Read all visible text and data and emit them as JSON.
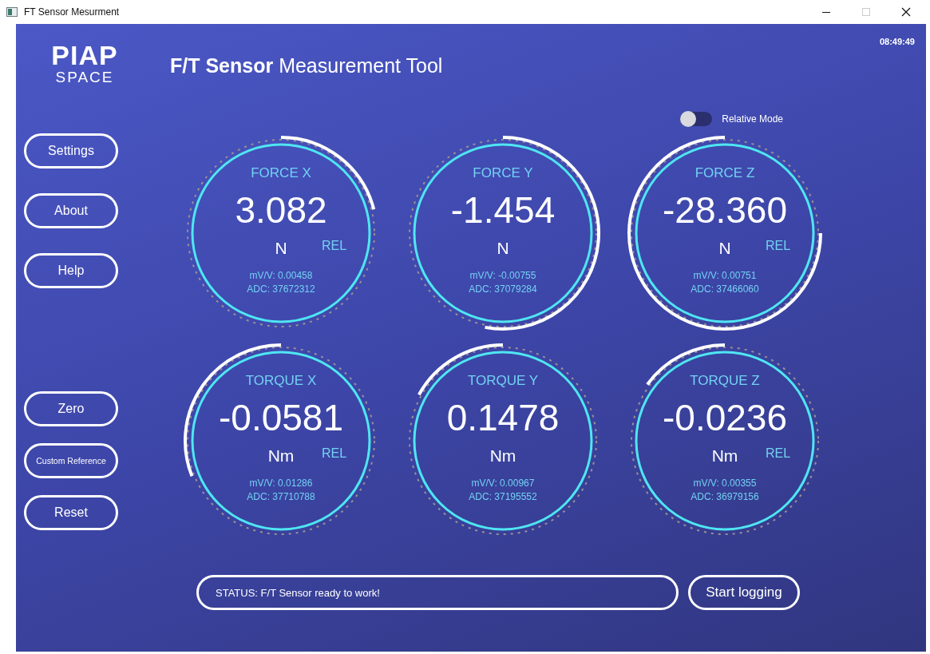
{
  "window": {
    "title": "FT Sensor Mesurment"
  },
  "logo": {
    "top": "PIAP",
    "bottom": "SPACE"
  },
  "title": {
    "bold": "F/T Sensor",
    "rest": "Measurement Tool"
  },
  "clock": "08:49:49",
  "relative_mode": {
    "label": "Relative Mode",
    "on": false
  },
  "sidebar": {
    "groups": [
      {
        "buttons": [
          "Settings",
          "About",
          "Help"
        ]
      },
      {
        "buttons": [
          "Zero",
          "Custom Reference",
          "Reset"
        ]
      }
    ]
  },
  "gauges": [
    {
      "label": "FORCE X",
      "value": "3.082",
      "unit": "N",
      "rel_badge": "REL",
      "mvv": "mV/V: 0.00458",
      "adc": "ADC: 37672312"
    },
    {
      "label": "FORCE Y",
      "value": "-1.454",
      "unit": "N",
      "mvv": "mV/V: -0.00755",
      "adc": "ADC: 37079284"
    },
    {
      "label": "FORCE Z",
      "value": "-28.360",
      "unit": "N",
      "rel_badge": "REL",
      "mvv": "mV/V: 0.00751",
      "adc": "ADC: 37466060"
    },
    {
      "label": "TORQUE X",
      "value": "-0.0581",
      "unit": "Nm",
      "rel_badge": "REL",
      "mvv": "mV/V: 0.01286",
      "adc": "ADC: 37710788"
    },
    {
      "label": "TORQUE Y",
      "value": "0.1478",
      "unit": "Nm",
      "mvv": "mV/V: 0.00967",
      "adc": "ADC: 37195552"
    },
    {
      "label": "TORQUE Z",
      "value": "-0.0236",
      "unit": "Nm",
      "rel_badge": "REL",
      "mvv": "mV/V: 0.00355",
      "adc": "ADC: 36979156"
    }
  ],
  "status": {
    "text": "STATUS: F/T Sensor ready to work!"
  },
  "log_button": "Start logging"
}
